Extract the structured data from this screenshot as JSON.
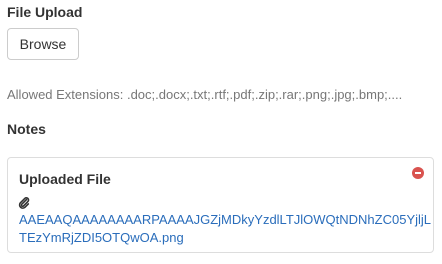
{
  "file_upload": {
    "label": "File Upload",
    "browse_label": "Browse",
    "allowed_extensions": "Allowed Extensions: .doc;.docx;.txt;.rtf;.pdf;.zip;.rar;.png;.jpg;.bmp;...."
  },
  "notes": {
    "label": "Notes"
  },
  "uploaded_file": {
    "title": "Uploaded File",
    "file_name": "AAEAAQAAAAAAAARPAAAAJGZjMDkyYzdlLTJlOWQtNDNhZC05YjljLTEzYmRjZDI5OTQwOA.png",
    "remove_icon": "remove-circle-icon",
    "attachment_icon": "paperclip-icon",
    "link_color": "#2a6dbb",
    "remove_color": "#d9534f"
  }
}
